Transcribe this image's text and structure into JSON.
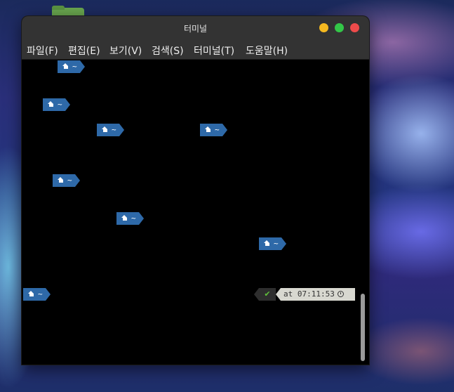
{
  "window": {
    "title": "터미널"
  },
  "menu": [
    {
      "label": "파일(F)"
    },
    {
      "label": "편집(E)"
    },
    {
      "label": "보기(V)"
    },
    {
      "label": "검색(S)"
    },
    {
      "label": "터미널(T)"
    },
    {
      "label": "도움말(H)"
    }
  ],
  "terminal": {
    "prompts": [
      {
        "text": "~"
      },
      {
        "text": "~"
      },
      {
        "text": "~"
      },
      {
        "text": "~"
      },
      {
        "text": "~"
      },
      {
        "text": "~"
      },
      {
        "text": "~"
      },
      {
        "text": "~"
      }
    ],
    "status_check": "✔",
    "time_text": "at 07:11:53"
  },
  "icons": {
    "prompt": "home-icon",
    "time": "clock-icon",
    "status": "check-icon"
  },
  "colors": {
    "prompt_bg": "#2e69a8",
    "titlebar": "#333333",
    "check": "#5fbf3a",
    "minimize": "#f5b920",
    "maximize": "#33c748",
    "close": "#ee4b4b"
  }
}
